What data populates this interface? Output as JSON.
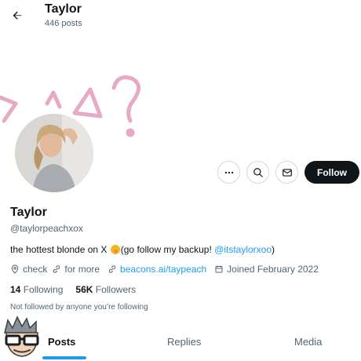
{
  "header": {
    "title": "Taylor",
    "post_count": "446 posts"
  },
  "profile": {
    "display_name": "Taylor",
    "handle": "@taylorpeachxox",
    "bio_before": "the hottest blonde on X ",
    "bio_after": "(go follow my backup! ",
    "bio_mention": "@itstaylorxoo",
    "bio_close": ")",
    "location": "check",
    "extra": "for more",
    "website": "beacons.ai/taypeach",
    "joined": "Joined February 2022",
    "following_count": "14",
    "following_label": "Following",
    "followers_count": "56K",
    "followers_label": "Followers",
    "not_followed": "Not followed by anyone you’re following"
  },
  "actions": {
    "follow_label": "Follow"
  },
  "tabs": [
    {
      "label": "Posts",
      "active": true
    },
    {
      "label": "Replies",
      "active": false
    },
    {
      "label": "Media",
      "active": false
    }
  ],
  "colors": {
    "accent": "#1d9bf0",
    "text": "#0f1419",
    "muted": "#536471",
    "banner_doodle": "#e7a9c4"
  },
  "icons": [
    "back-arrow-icon",
    "more-icon",
    "search-icon",
    "mail-icon",
    "location-icon",
    "link-icon",
    "calendar-icon"
  ]
}
